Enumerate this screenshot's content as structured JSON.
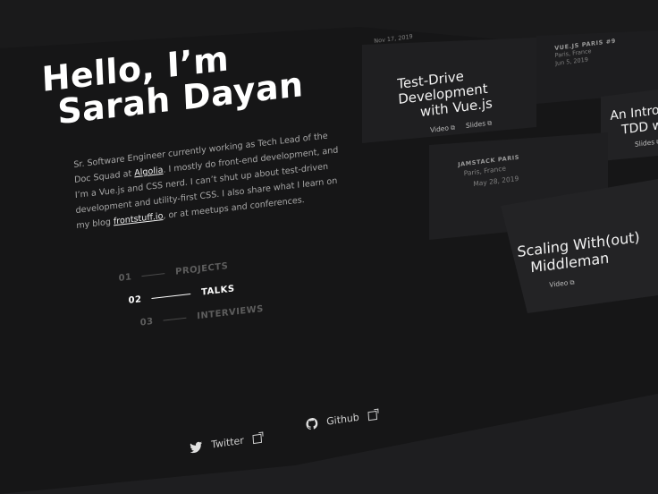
{
  "hero": {
    "title_line1": "Hello, I’m",
    "title_line2": "Sarah Dayan",
    "bio_1": "Sr. Software Engineer currently working as Tech Lead of the Doc Squad at ",
    "bio_link_algolia": "Algolia",
    "bio_2": ". I mostly do front-end development, and I’m a Vue.js and CSS nerd. I can’t shut up about test-driven development and utility-first CSS. I also share what I learn on my blog ",
    "bio_link_blog": "frontstuff.io",
    "bio_3": ", or at meetups and conferences."
  },
  "nav": [
    {
      "num": "01",
      "label": "PROJECTS"
    },
    {
      "num": "02",
      "label": "TALKS"
    },
    {
      "num": "03",
      "label": "INTERVIEWS"
    }
  ],
  "social": {
    "twitter": "Twitter",
    "github": "Github"
  },
  "talks": {
    "top_meta_date": "Nov 17, 2019",
    "card1": {
      "title_1": "Test-Drive",
      "title_2": "Development",
      "title_3": "with Vue.js",
      "video": "Video",
      "slides": "Slides"
    },
    "card2": {
      "event": "VUE.JS PARIS #9",
      "location": "Paris, France",
      "date": "Jun 5, 2019"
    },
    "card3": {
      "title_1": "An Intro",
      "title_2": "TDD w",
      "slides": "Slides"
    },
    "card4": {
      "event": "JAMSTACK PARIS",
      "location": "Paris, France",
      "date": "May 28, 2019"
    },
    "card5": {
      "title_1": "Scaling With(out)",
      "title_2": "Middleman",
      "video": "Video"
    }
  },
  "colors": {
    "bg": "#161617",
    "card": "#202022",
    "text": "#ffffff",
    "muted": "#5d5d5d"
  }
}
